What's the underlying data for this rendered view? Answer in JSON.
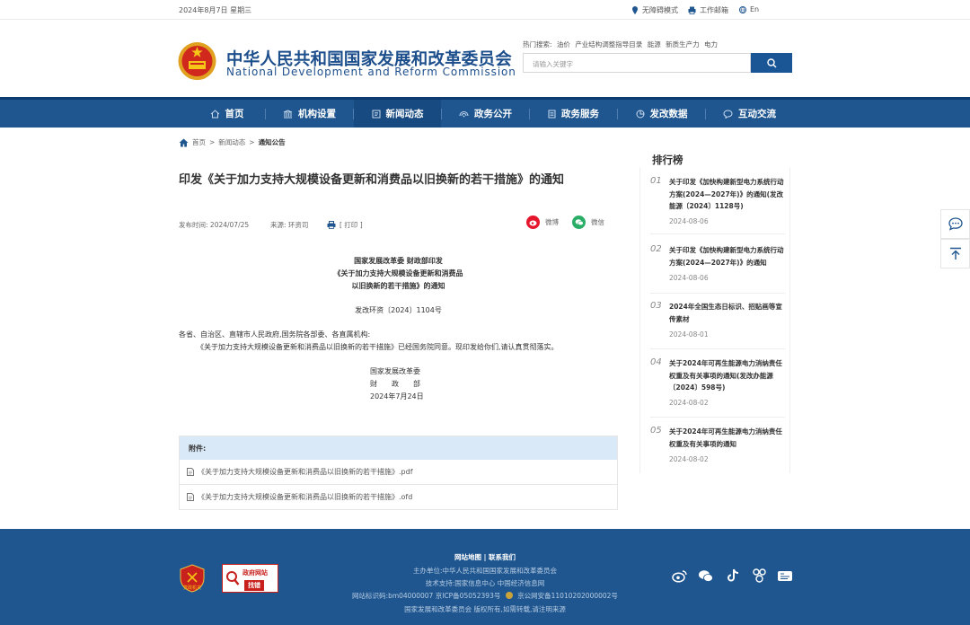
{
  "topbar": {
    "date": "2024年8月7日 星期三",
    "accessible": "无障碍模式",
    "work_portal": "工作邮箱",
    "lang": "En"
  },
  "header": {
    "cn_title": "中华人民共和国国家发展和改革委员会",
    "en_title": "National Development and Reform Commission",
    "hot_search_label": "热门搜索:",
    "hot_search": [
      "油价",
      "产业结构调整指导目录",
      "能源",
      "新质生产力",
      "电力"
    ],
    "search_placeholder": "请输入关键字"
  },
  "nav": {
    "items": [
      {
        "label": "首页",
        "icon": "home-icon"
      },
      {
        "label": "机构设置",
        "icon": "building-icon"
      },
      {
        "label": "新闻动态",
        "icon": "news-icon"
      },
      {
        "label": "政务公开",
        "icon": "broadcast-icon"
      },
      {
        "label": "政务服务",
        "icon": "document-icon"
      },
      {
        "label": "发改数据",
        "icon": "chart-pie-icon"
      },
      {
        "label": "互动交流",
        "icon": "chat-icon"
      }
    ],
    "active": "新闻动态"
  },
  "breadcrumb": {
    "home": "首页",
    "news": "新闻动态",
    "current": "通知公告",
    "sep": ">"
  },
  "article": {
    "title": "印发《关于加力支持大规模设备更新和消费品以旧换新的若干措施》的通知",
    "publish_label": "发布时间:",
    "publish_date": "2024/07/25",
    "source_label": "来源:",
    "source": "环资司",
    "print": "[ 打印 ]",
    "share_weibo": "微博",
    "share_wechat": "微信",
    "issuers": "国家发展改革委 财政部印发",
    "doc_title_1": "《关于加力支持大规模设备更新和消费品",
    "doc_title_2": "以旧换新的若干措施》的通知",
    "doc_no": "发改环资〔2024〕1104号",
    "addressee": "各省、自治区、直辖市人民政府,国务院各部委、各直属机构:",
    "para": "《关于加力支持大规模设备更新和消费品以旧换新的若干措施》已经国务院同意。现印发给你们,请认真贯彻落实。",
    "sign_1": "国家发展改革委",
    "sign_2": "财　　政　　部",
    "sign_date": "2024年7月24日"
  },
  "attachments": {
    "label": "附件:",
    "items": [
      "《关于加力支持大规模设备更新和消费品以旧换新的若干措施》.pdf",
      "《关于加力支持大规模设备更新和消费品以旧换新的若干措施》.ofd"
    ]
  },
  "ranking": {
    "title": "排行榜",
    "items": [
      {
        "num": "01",
        "text": "关于印发《加快构建新型电力系统行动方案(2024—2027年)》的通知(发改能源〔2024〕1128号)",
        "date": "2024-08-06"
      },
      {
        "num": "02",
        "text": "关于印发《加快构建新型电力系统行动方案(2024—2027年)》的通知",
        "date": "2024-08-06"
      },
      {
        "num": "03",
        "text": "2024年全国生态日标识、招贴画等宣传素材",
        "date": "2024-08-01"
      },
      {
        "num": "04",
        "text": "关于2024年可再生能源电力消纳责任权重及有关事项的通知(发改办能源〔2024〕598号)",
        "date": "2024-08-02"
      },
      {
        "num": "05",
        "text": "关于2024年可再生能源电力消纳责任权重及有关事项的通知",
        "date": "2024-08-02"
      }
    ]
  },
  "footer": {
    "links": "网站地图 | 联系我们",
    "sponsor": "主办单位:中华人民共和国国家发展和改革委员会",
    "support": "技术支持:国家信息中心 中国经济信息网",
    "record": "网站标识码:bm04000007 京ICP备05052393号",
    "police": "京公网安备11010202000002号",
    "copyright": "国家发展和改革委员会 版权所有,如需转载,请注明来源",
    "gov_badge_1": "政府网站",
    "gov_badge_2": "找错",
    "party_badge": "党政机关"
  },
  "colors": {
    "primary": "#1f568f",
    "title_blue": "#1d4f8c",
    "attach_bg": "#d9e9f8"
  }
}
